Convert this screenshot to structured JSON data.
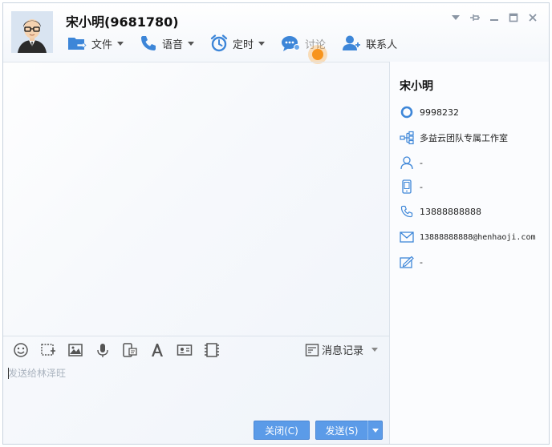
{
  "header": {
    "title": "宋小明(9681780)"
  },
  "toolbar": {
    "file": "文件",
    "voice": "语音",
    "schedule": "定时",
    "discuss": "讨论",
    "contacts": "联系人"
  },
  "input": {
    "placeholder": "发送给林泽旺"
  },
  "input_toolbar": {
    "history": "消息记录"
  },
  "buttons": {
    "close": "关闭(C)",
    "send": "发送(S)"
  },
  "profile": {
    "name": "宋小明",
    "qq": "9998232",
    "org": "多益云团队专属工作室",
    "person": "-",
    "phone_device": "-",
    "phone": "13888888888",
    "email": "13888888888@henhaoji.com",
    "signature": "-"
  },
  "colors": {
    "accent": "#5b9be8",
    "icon_blue": "#3d86d8",
    "cursor": "#f7941d"
  }
}
